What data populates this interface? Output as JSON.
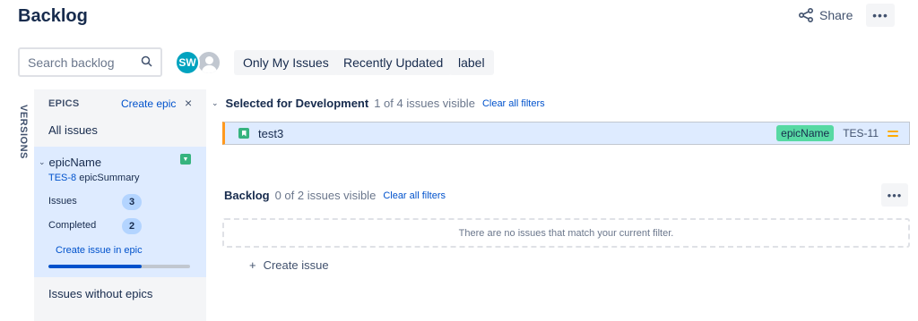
{
  "header": {
    "title": "Backlog",
    "share_label": "Share",
    "share_icon": "share-icon",
    "more_label": "•••"
  },
  "filters": {
    "search_placeholder": "Search backlog",
    "search_value": "",
    "avatar_initials": "SW",
    "avatar_color": "#00a3bf",
    "chips": [
      "Only My Issues",
      "Recently Updated",
      "label"
    ]
  },
  "side_tabs": {
    "versions_label": "VERSIONS"
  },
  "epics_panel": {
    "title": "EPICS",
    "create_label": "Create epic",
    "close_label": "×",
    "all_issues_label": "All issues",
    "epic": {
      "name": "epicName",
      "key": "TES-8",
      "summary": "epicSummary",
      "issues_label": "Issues",
      "issues_count": "3",
      "completed_label": "Completed",
      "completed_count": "2",
      "create_issue_label": "Create issue in epic",
      "progress_fraction": 0.66,
      "color": "#36b37e"
    },
    "without_epics_label": "Issues without epics"
  },
  "sprint": {
    "name": "Selected for Development",
    "count_text": "1 of 4 issues visible",
    "clear_label": "Clear all filters",
    "issues": [
      {
        "summary": "test3",
        "type": "story",
        "epic_label": "epicName",
        "key": "TES-11",
        "priority": "medium"
      }
    ]
  },
  "backlog": {
    "name": "Backlog",
    "count_text": "0 of 2 issues visible",
    "clear_label": "Clear all filters",
    "empty_text": "There are no issues that match your current filter.",
    "create_label": "Create issue",
    "create_prefix": "+",
    "more_label": "•••"
  },
  "colors": {
    "accent": "#0052cc",
    "selected_bg": "#deebff",
    "epic_lozenge": "#57d9a3",
    "priority_medium": "#ffab00",
    "sprint_border": "#ff991f"
  }
}
